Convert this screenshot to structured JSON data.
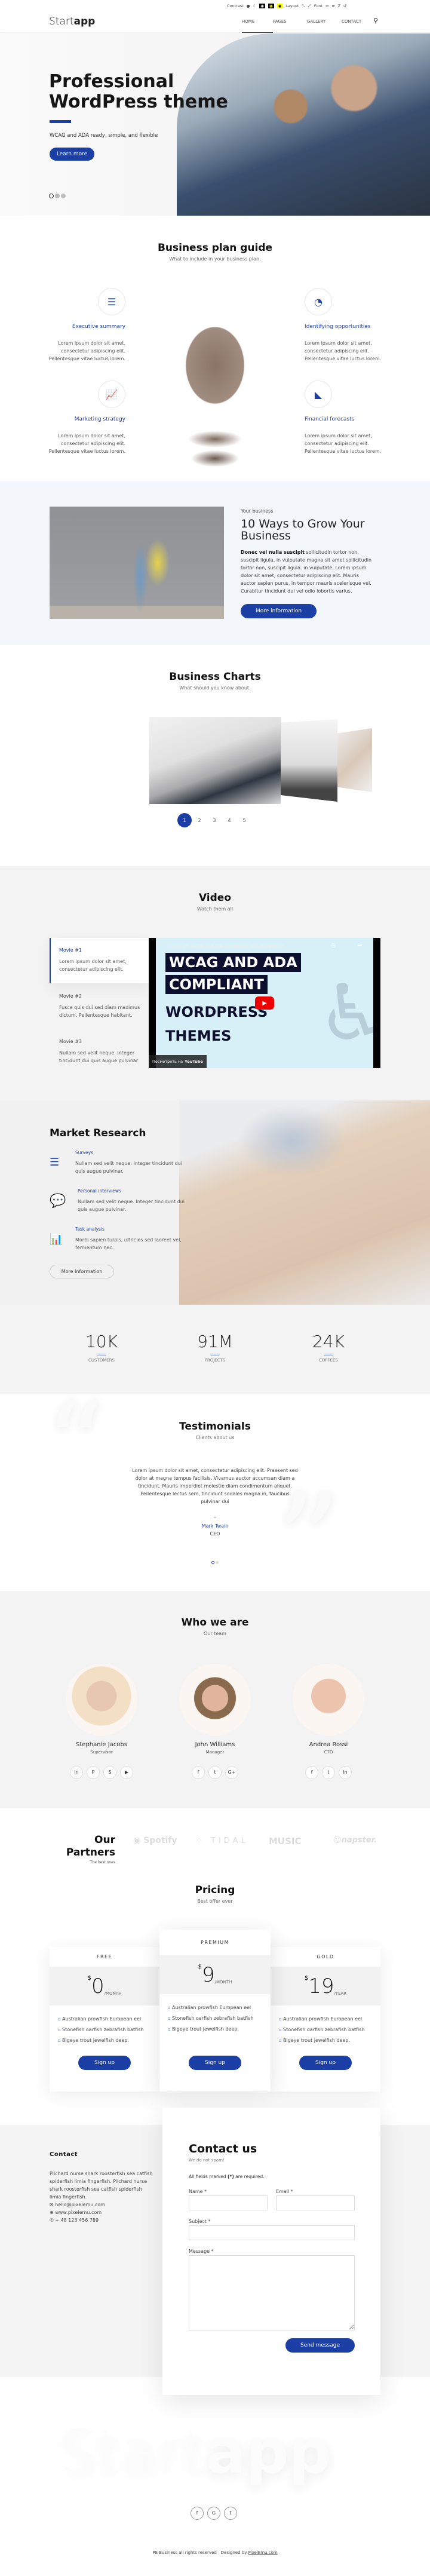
{
  "topbar": {
    "contrast_label": "Contrast",
    "layout_label": "Layout",
    "font_label": "Font"
  },
  "header": {
    "logo_light": "Start",
    "logo_bold": "app",
    "nav": [
      "HOME",
      "PAGES",
      "GALLERY",
      "CONTACT"
    ],
    "active": "HOME"
  },
  "hero": {
    "title_line1": "Professional",
    "title_line2": "WordPress theme",
    "subtitle": "WCAG and ADA ready, simple, and flexible",
    "button": "Learn more",
    "slides": 3,
    "active_slide": 1
  },
  "plan": {
    "title": "Business plan guide",
    "subtitle": "What to include in your business plan.",
    "items": [
      {
        "title": "Executive summary",
        "icon": "list-icon",
        "text": [
          "Lorem ipsum dolor sit amet,",
          "consectetur adipiscing elit.",
          "Pellentesque vitae luctus lorem."
        ]
      },
      {
        "title": "Identifying opportunities",
        "icon": "pie-chart-icon",
        "text": [
          "Lorem ipsum dolor sit amet,",
          "consectetur adipiscing elit.",
          "Pellentesque vitae luctus lorem."
        ]
      },
      {
        "title": "Marketing strategy",
        "icon": "line-chart-icon",
        "text": [
          "Lorem ipsum dolor sit amet,",
          "consectetur adipiscing elit.",
          "Pellentesque vitae luctus lorem."
        ]
      },
      {
        "title": "Financial forecasts",
        "icon": "area-chart-icon",
        "text": [
          "Lorem ipsum dolor sit amet,",
          "consectetur adipiscing elit.",
          "Pellentesque vitae luctus lorem."
        ]
      }
    ]
  },
  "business": {
    "eyebrow": "Your business",
    "title": "10 Ways to Grow Your Business",
    "lead_bold": "Donec vel nulla suscipit",
    "body": " sollicitudin tortor non, suscipit ligula. in vulputate magna sit amet sollicitudin tortor non, suscipit ligula. in vulputate. Lorem ipsum dolor sit amet, consectetur adipiscing elit. Mauris auctor sapien purus, in tempor mauris scelerisque vel. Curabitur tincidunt dui vel odio lobortis varius.",
    "button": "More information"
  },
  "charts": {
    "title": "Business Charts",
    "subtitle": "What should you know about.",
    "pages": [
      "1",
      "2",
      "3",
      "4",
      "5"
    ],
    "active_page": "1"
  },
  "video": {
    "title": "Video",
    "subtitle": "Watch them all",
    "items": [
      {
        "title": "Movie #1",
        "text": "Lorem ipsum dolor sit amet, consectetur adipiscing elit."
      },
      {
        "title": "Movie #2",
        "text": "Fusce quis dui sed diam maximus dictum. Pellentesque habitant."
      },
      {
        "title": "Movie #3",
        "text": "Nullam sed velit neque. Integer tincidunt dui quis augue pulvinar"
      }
    ],
    "player": {
      "caption": "How to get WCAG and ADA compliance with WordPress?",
      "thumb_lines": [
        "WCAG AND ADA",
        "COMPLIANT",
        "WORDPRESS",
        "THEMES"
      ],
      "watch_on": "Посмотреть на",
      "youtube": "YouTube"
    }
  },
  "market": {
    "title": "Market Research",
    "items": [
      {
        "title": "Surveys",
        "icon": "numbered-list-icon",
        "text": "Nullam sed velit neque. Integer tincidunt dui quis augue pulvinar."
      },
      {
        "title": "Personal interviews",
        "icon": "chat-bubbles-icon",
        "text": "Nullam sed velit neque. Integer tincidunt dui quis augue pulvinar."
      },
      {
        "title": "Task analysis",
        "icon": "bar-chart-icon",
        "text": "Morbi sapien turpis, ultricies sed laoreet vel, fermentum nec."
      }
    ],
    "button": "More Information"
  },
  "stats": [
    {
      "value": "10K",
      "label": "CUSTOMERS"
    },
    {
      "value": "91M",
      "label": "PROJECTS"
    },
    {
      "value": "24K",
      "label": "COFFEES"
    }
  ],
  "testimonials": {
    "title": "Testimonials",
    "subtitle": "Clients about us",
    "quote": "Lorem ipsum dolor sit amet, consectetur adipiscing elit. Praesent sed dolor at magna tempus facilisis. Vivamus auctor accumsan diam a tincidunt. Mauris imperdiet molestie diam condimentum aliquet. Pellentesque lectus sem, tincidunt sodales magna in, faucibus pulvinar dui",
    "dash": "–",
    "author": "Mark Twain",
    "role": "CEO",
    "slides": 2,
    "active_slide": 1
  },
  "team": {
    "title": "Who we are",
    "subtitle": "Our team",
    "members": [
      {
        "name": "Stephanie Jacobs",
        "role": "Supervisor",
        "social": [
          "in",
          "P",
          "S",
          "▶"
        ]
      },
      {
        "name": "John Williams",
        "role": "Manager",
        "social": [
          "f",
          "t",
          "G+"
        ]
      },
      {
        "name": "Andrea Rossi",
        "role": "CTO",
        "social": [
          "f",
          "t",
          "in"
        ]
      }
    ]
  },
  "partners": {
    "title_line1": "Our",
    "title_line2": "Partners",
    "subtitle": "The best ones",
    "logos": [
      "Spotify",
      "TIDAL",
      "MUSIC",
      "napster."
    ]
  },
  "pricing": {
    "title": "Pricing",
    "subtitle": "Best offer ever",
    "plans": [
      {
        "name": "FREE",
        "currency": "$",
        "price": "0",
        "period": "/MONTH",
        "features": [
          "Australian prowfish European eel",
          "Stonefish oarfish zebrafish batfish",
          "Bigeye trout jewelfish deep."
        ],
        "button": "Sign up"
      },
      {
        "name": "PREMIUM",
        "currency": "$",
        "price": "9",
        "period": "/MONTH",
        "features": [
          "Australian prowfish European eel",
          "Stonefish oarfish zebrafish batfish",
          "Bigeye trout jewelfish deep."
        ],
        "button": "Sign up"
      },
      {
        "name": "GOLD",
        "currency": "$",
        "price": "19",
        "period": "/YEAR",
        "features": [
          "Australian prowfish European eel",
          "Stonefish oarfish zebrafish batfish",
          "Bigeye trout jewelfish deep."
        ],
        "button": "Sign up"
      }
    ]
  },
  "contact": {
    "title": "Contact",
    "text": "Pilchard nurse shark roosterfish sea catfish spiderfish limia fingerfish. Pilchard nurse shark roosterfish sea catfish spiderfish limia fingerfish.",
    "email": "hello@pixelemu.com",
    "web": "www.pixelemu.com",
    "phone": "+ 48 123 456 789"
  },
  "form": {
    "title": "Contact us",
    "subtitle": "We do not spam!",
    "required_note_a": "All fields marked ",
    "required_mark": "(*)",
    "required_note_b": " are required.",
    "name_label": "Name *",
    "email_label": "Email *",
    "subject_label": "Subject *",
    "message_label": "Message *",
    "name_value": "",
    "email_value": "",
    "subject_value": "",
    "message_value": "",
    "button": "Send message"
  },
  "footer": {
    "watermark_light": "Start",
    "watermark_bold": "app",
    "social": [
      "f",
      "G",
      "t"
    ],
    "copyright": "PE Business all rights reserved",
    "designed_by": "Designed by ",
    "designer_link": "PixelEmu.com"
  },
  "colors": {
    "accent": "#1c3fa6",
    "light_bg": "#f3f3f3",
    "blue_bg": "#f3f6fa"
  }
}
